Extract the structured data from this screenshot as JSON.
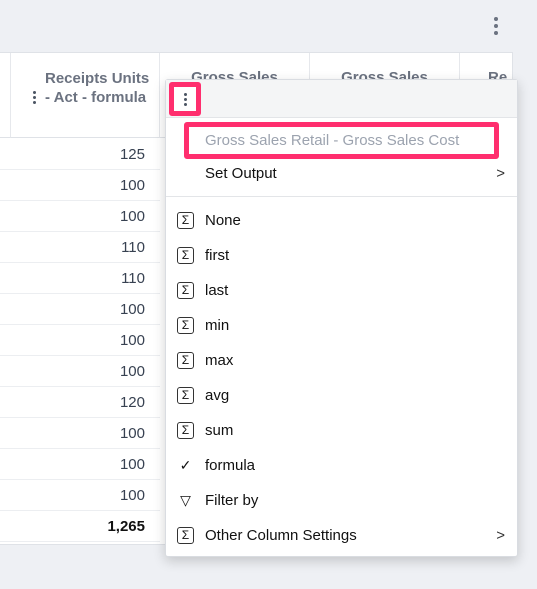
{
  "toolbar": {
    "more_icon": "kebab-vertical-icon"
  },
  "table": {
    "columns": [
      {
        "label": "Receipts Units - Act - formula"
      },
      {
        "label": "Gross Sales"
      },
      {
        "label": "Gross Sales"
      },
      {
        "label": "Re"
      }
    ],
    "rows": [
      "125",
      "100",
      "100",
      "110",
      "110",
      "100",
      "100",
      "100",
      "120",
      "100",
      "100",
      "100"
    ],
    "total": "1,265"
  },
  "menu": {
    "formula_value": "Gross Sales Retail - Gross Sales Cost",
    "set_output": "Set Output",
    "items": [
      {
        "label": "None",
        "icon": "sigma-icon"
      },
      {
        "label": "first",
        "icon": "sigma-icon"
      },
      {
        "label": "last",
        "icon": "sigma-icon"
      },
      {
        "label": "min",
        "icon": "sigma-icon"
      },
      {
        "label": "max",
        "icon": "sigma-icon"
      },
      {
        "label": "avg",
        "icon": "sigma-icon"
      },
      {
        "label": "sum",
        "icon": "sigma-icon"
      },
      {
        "label": "formula",
        "icon": "check-icon",
        "checked": true
      },
      {
        "label": "Filter by",
        "icon": "filter-icon"
      },
      {
        "label": "Other Column Settings",
        "icon": "sigma-icon",
        "submenu": true
      }
    ]
  },
  "colors": {
    "highlight": "#ff2e6e"
  }
}
